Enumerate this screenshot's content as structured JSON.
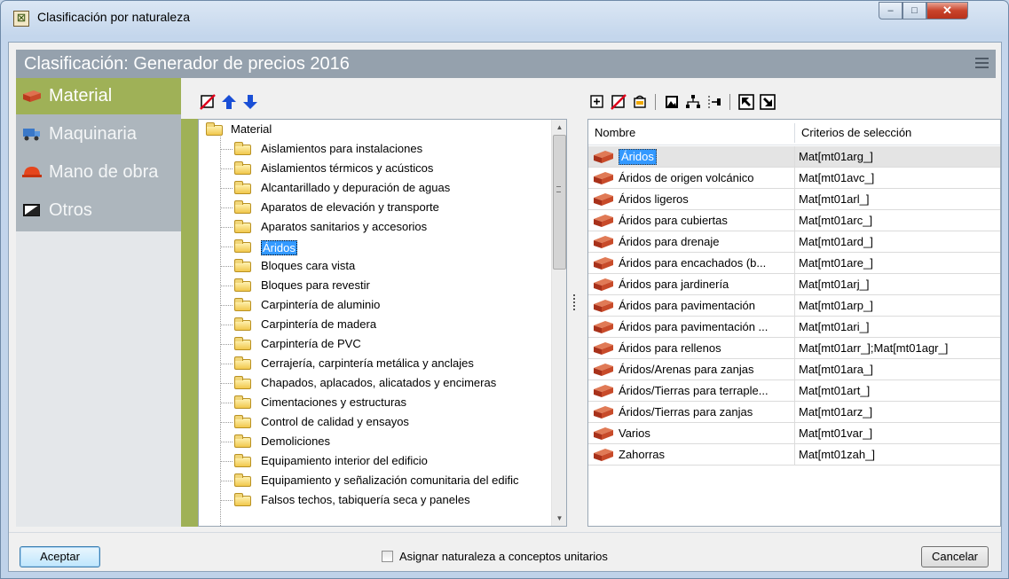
{
  "window": {
    "title": "Clasificación por naturaleza",
    "minimize": "–",
    "maximize": "□",
    "close": "✕"
  },
  "header": {
    "title": "Clasificación: Generador de precios 2016",
    "menu_icon": "hamburger-menu-icon"
  },
  "categories": [
    {
      "label": "Material",
      "icon": "brick-icon",
      "active": true
    },
    {
      "label": "Maquinaria",
      "icon": "truck-icon",
      "active": false
    },
    {
      "label": "Mano de obra",
      "icon": "hard-hat-icon",
      "active": false
    },
    {
      "label": "Otros",
      "icon": "box-icon",
      "active": false
    }
  ],
  "tree_toolbar": [
    "delete-icon",
    "move-up-icon",
    "move-down-icon"
  ],
  "tree": {
    "root": "Material",
    "selected": "Áridos",
    "items": [
      "Aislamientos para instalaciones",
      "Aislamientos térmicos y acústicos",
      "Alcantarillado y depuración de aguas",
      "Aparatos de elevación y transporte",
      "Aparatos sanitarios y accesorios",
      "Áridos",
      "Bloques cara vista",
      "Bloques para revestir",
      "Carpintería de aluminio",
      "Carpintería de madera",
      "Carpintería de PVC",
      "Cerrajería, carpintería metálica y anclajes",
      "Chapados, aplacados, alicatados y encimeras",
      "Cimentaciones y estructuras",
      "Control de calidad y ensayos",
      "Demoliciones",
      "Equipamiento interior del edificio",
      "Equipamiento y señalización comunitaria del edific",
      "Falsos techos, tabiquería seca y paneles"
    ]
  },
  "grid_toolbar": [
    "add-row-icon",
    "delete-row-icon",
    "edit-icon",
    "image-icon",
    "tree-structure-icon",
    "insert-column-icon",
    "expand-icon",
    "collapse-icon"
  ],
  "grid": {
    "columns": [
      "Nombre",
      "Criterios de selección"
    ],
    "rows": [
      {
        "name": "Áridos",
        "criteria": "Mat[mt01arg_]",
        "selected": true
      },
      {
        "name": "Áridos de origen volcánico",
        "criteria": "Mat[mt01avc_]"
      },
      {
        "name": "Áridos ligeros",
        "criteria": "Mat[mt01arl_]"
      },
      {
        "name": "Áridos para cubiertas",
        "criteria": "Mat[mt01arc_]"
      },
      {
        "name": "Áridos para drenaje",
        "criteria": "Mat[mt01ard_]"
      },
      {
        "name": "Áridos para encachados (b...",
        "criteria": "Mat[mt01are_]"
      },
      {
        "name": "Áridos para jardinería",
        "criteria": "Mat[mt01arj_]"
      },
      {
        "name": "Áridos para pavimentación",
        "criteria": "Mat[mt01arp_]"
      },
      {
        "name": "Áridos para pavimentación ...",
        "criteria": "Mat[mt01ari_]"
      },
      {
        "name": "Áridos para rellenos",
        "criteria": "Mat[mt01arr_];Mat[mt01agr_]"
      },
      {
        "name": "Áridos/Arenas para zanjas",
        "criteria": "Mat[mt01ara_]"
      },
      {
        "name": "Áridos/Tierras para terraple...",
        "criteria": "Mat[mt01art_]"
      },
      {
        "name": "Áridos/Tierras para zanjas",
        "criteria": "Mat[mt01arz_]"
      },
      {
        "name": "Varios",
        "criteria": "Mat[mt01var_]"
      },
      {
        "name": "Zahorras",
        "criteria": "Mat[mt01zah_]"
      }
    ]
  },
  "footer": {
    "ok_label": "Aceptar",
    "checkbox_label": "Asignar naturaleza a conceptos unitarios",
    "checkbox_checked": false,
    "cancel_label": "Cancelar"
  },
  "colors": {
    "accent": "#9fb157",
    "header": "#95a1ad",
    "selection": "#3399ff"
  }
}
